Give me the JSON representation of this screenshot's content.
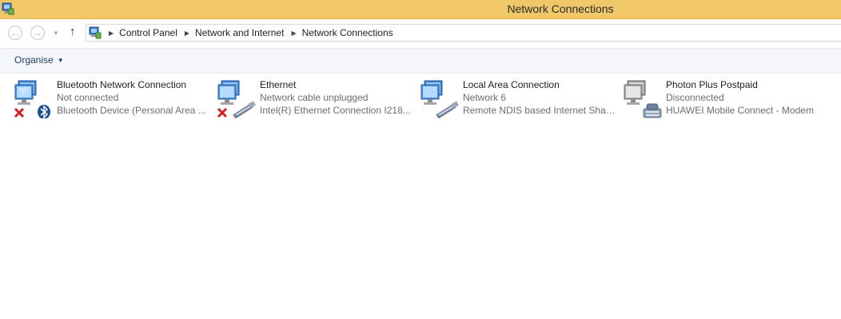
{
  "window": {
    "title": "Network Connections",
    "icon": "network-connections-icon"
  },
  "navigation": {
    "back_icon": "back-arrow-icon",
    "forward_icon": "forward-arrow-icon",
    "recent_icon": "chevron-down-icon",
    "up_icon": "up-arrow-icon",
    "breadcrumb": [
      "Control Panel",
      "Network and Internet",
      "Network Connections"
    ]
  },
  "toolbar": {
    "organise_label": "Organise"
  },
  "connections": [
    {
      "name": "Bluetooth Network Connection",
      "status": "Not connected",
      "device": "Bluetooth Device (Personal Area ...",
      "overlay": "red-x-icon",
      "adapter": "bluetooth-icon"
    },
    {
      "name": "Ethernet",
      "status": "Network cable unplugged",
      "device": "Intel(R) Ethernet Connection I218...",
      "overlay": "red-x-icon",
      "adapter": "network-cable-icon"
    },
    {
      "name": "Local Area Connection",
      "status": "Network  6",
      "device": "Remote NDIS based Internet Shari...",
      "overlay": "",
      "adapter": "network-cable-icon"
    },
    {
      "name": "Photon Plus Postpaid",
      "status": "Disconnected",
      "device": "HUAWEI Mobile Connect - Modem",
      "overlay": "",
      "adapter": "modem-phone-icon"
    }
  ],
  "colors": {
    "titlebar": "#f0c769",
    "commandbar": "#f4f6f9",
    "link_text": "#1f3f66",
    "secondary_text": "#6d6d6d",
    "error_red": "#d42020",
    "bluetooth_blue": "#1f4f8f"
  }
}
